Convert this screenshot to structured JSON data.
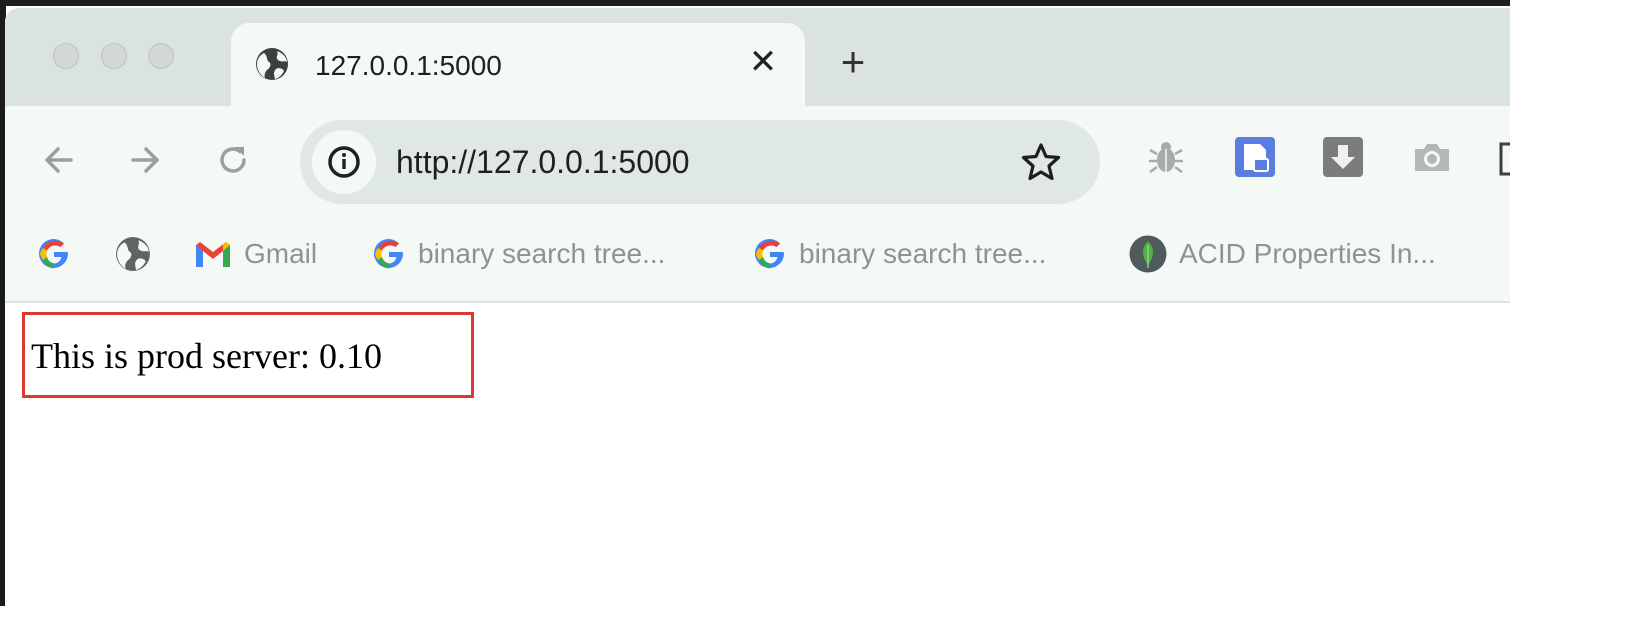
{
  "browser": {
    "tab": {
      "title": "127.0.0.1:5000",
      "close_symbol": "✕"
    },
    "new_tab_symbol": "+",
    "address_bar": {
      "url": "http://127.0.0.1:5000"
    },
    "bookmarks": [
      {
        "icon": "google-icon",
        "label": ""
      },
      {
        "icon": "globe-icon",
        "label": ""
      },
      {
        "icon": "gmail-icon",
        "label": "Gmail"
      },
      {
        "icon": "google-icon",
        "label": "binary search tree..."
      },
      {
        "icon": "google-icon",
        "label": "binary search tree..."
      },
      {
        "icon": "mongodb-leaf-icon",
        "label": "ACID Properties In..."
      }
    ],
    "extensions": [
      "bug-icon",
      "lock-file-icon",
      "download-icon",
      "camera-icon",
      "puzzle-icon"
    ]
  },
  "page": {
    "content": "This is prod server: 0.10",
    "highlight_color": "#d9382d"
  }
}
